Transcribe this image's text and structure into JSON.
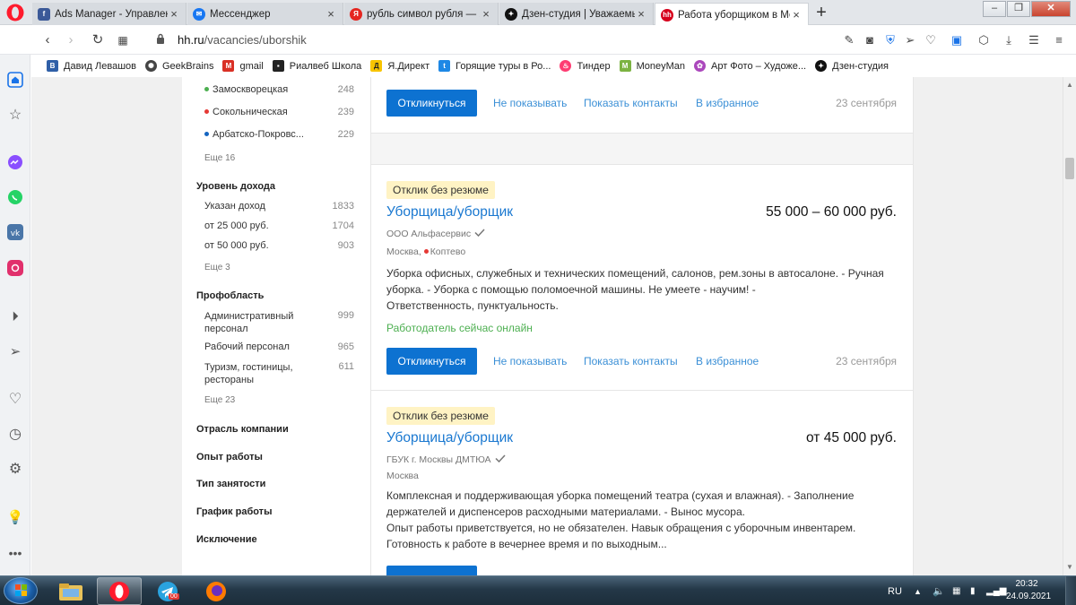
{
  "browser": {
    "tabs": [
      {
        "title": "Ads Manager - Управлени",
        "favicon": "facebook-icon",
        "color": "#3b5998"
      },
      {
        "title": "Мессенджер",
        "favicon": "messenger-icon",
        "color": "#1877f2"
      },
      {
        "title": "рубль символ рубля — Ян",
        "favicon": "yandex-icon",
        "color": "#e52620"
      },
      {
        "title": "Дзен-студия | Уважаемые",
        "favicon": "dzen-icon",
        "color": "#111111"
      },
      {
        "title": "Работа уборщиком в Мос",
        "favicon": "hh-icon",
        "color": "#d6001c"
      }
    ],
    "address": {
      "domain": "hh.ru",
      "path": "/vacancies/uborshik"
    },
    "bookmarks": [
      {
        "label": "Давид Левашов",
        "icon": "vk-profile-icon",
        "color": "#2f5fa7"
      },
      {
        "label": "GeekBrains",
        "icon": "geekbrains-icon",
        "color": "#444444"
      },
      {
        "label": "gmail",
        "icon": "gmail-icon",
        "color": "#d93025"
      },
      {
        "label": "Риалвеб Школа",
        "icon": "rialweb-icon",
        "color": "#222222"
      },
      {
        "label": "Я.Директ",
        "icon": "yandex-direct-icon",
        "color": "#f8c400"
      },
      {
        "label": "Горящие туры в Ро...",
        "icon": "tours-icon",
        "color": "#1e88e5"
      },
      {
        "label": "Тиндер",
        "icon": "tinder-icon",
        "color": "#fe3c72"
      },
      {
        "label": "MoneyMan",
        "icon": "moneyman-icon",
        "color": "#7cb342"
      },
      {
        "label": "Арт Фото – Художе...",
        "icon": "art-photo-icon",
        "color": "#ab47bc"
      },
      {
        "label": "Дзен-студия",
        "icon": "dzen-icon",
        "color": "#111111"
      }
    ]
  },
  "filters": {
    "metro": [
      {
        "label": "Замоскворецкая",
        "count": "248",
        "color": "#4caf50"
      },
      {
        "label": "Сокольническая",
        "count": "239",
        "color": "#e53935"
      },
      {
        "label": "Арбатско-Покровс...",
        "count": "229",
        "color": "#1565c0"
      }
    ],
    "metro_more": "Еще 16",
    "income": {
      "title": "Уровень дохода",
      "items": [
        {
          "label": "Указан доход",
          "count": "1833"
        },
        {
          "label": "от 25 000 руб.",
          "count": "1704"
        },
        {
          "label": "от 50 000 руб.",
          "count": "903"
        }
      ],
      "more": "Еще 3"
    },
    "profarea": {
      "title": "Профобласть",
      "items": [
        {
          "label_1": "Административный",
          "label_2": "персонал",
          "count": "999"
        },
        {
          "label_1": "Рабочий персонал",
          "label_2": "",
          "count": "965"
        },
        {
          "label_1": "Туризм, гостиницы,",
          "label_2": "рестораны",
          "count": "611"
        }
      ],
      "more": "Еще 23"
    },
    "sections": [
      "Отрасль компании",
      "Опыт работы",
      "Тип занятости",
      "График работы",
      "Исключение"
    ]
  },
  "actions": {
    "respond": "Откликнуться",
    "hide": "Не показывать",
    "contacts": "Показать контакты",
    "favorite": "В избранное"
  },
  "vacancies": [
    {
      "date": "23 сентября"
    },
    {
      "badge": "Отклик без резюме",
      "title": "Уборщица/уборщик",
      "salary": "55 000 – 60 000 руб.",
      "company": "ООО Альфасервис",
      "city": "Москва,",
      "metro": "Коптево",
      "metro_color": "#e53935",
      "desc_1": "Уборка офисных, служебных и технических помещений, салонов, рем.зоны в автосалоне. - Ручная",
      "desc_2": "уборка. - Уборка с помощью поломоечной машины. Не умеете - научим! -",
      "desc_3": "Ответственность, пунктуальность.",
      "online": "Работодатель сейчас онлайн",
      "date": "23 сентября"
    },
    {
      "badge": "Отклик без резюме",
      "title": "Уборщица/уборщик",
      "salary": "от 45 000 руб.",
      "company": "ГБУК г. Москвы ДМТЮА",
      "city": "Москва",
      "desc_1": "Комплексная и поддерживающая уборка помещений театра (сухая и влажная). - Заполнение",
      "desc_2": "держателей и диспенсеров расходными материалами. - Вынос мусора.",
      "desc_3": "Опыт работы приветствуется, но не обязателен. Навык обращения с уборочным инвентарем.",
      "desc_4": "Готовность к работе в вечернее время и по выходным..."
    }
  ],
  "taskbar": {
    "lang": "RU",
    "time": "20:32",
    "date": "24.09.2021",
    "telegram_badge": "00"
  }
}
